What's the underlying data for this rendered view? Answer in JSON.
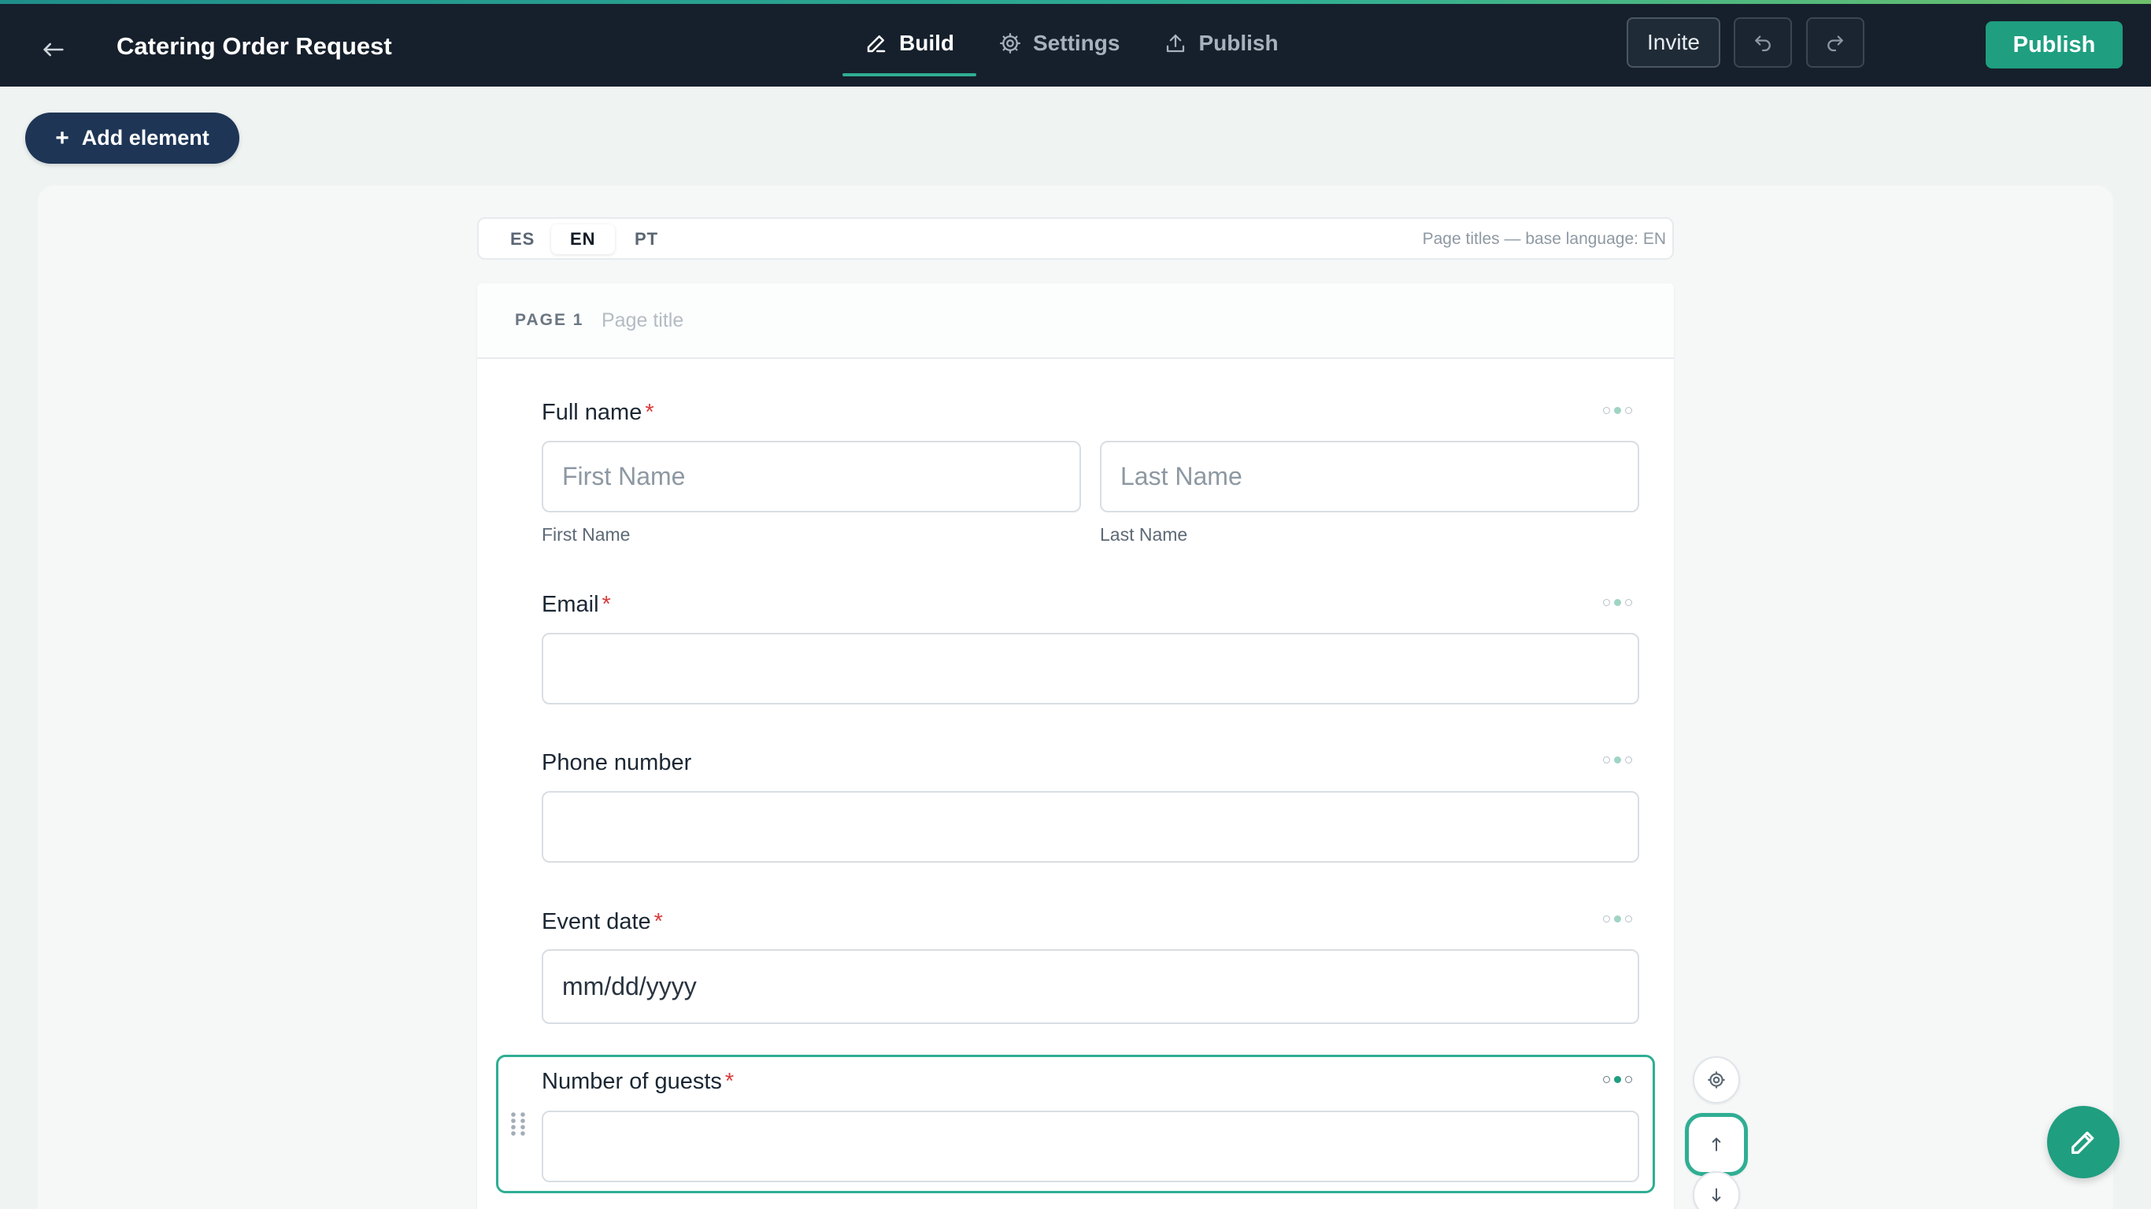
{
  "header": {
    "title": "Catering Order Request",
    "tabs": [
      {
        "label": "Build",
        "icon": "pencil-icon",
        "active": true
      },
      {
        "label": "Settings",
        "icon": "gear-icon",
        "active": false
      },
      {
        "label": "Publish",
        "icon": "upload-icon",
        "active": false
      }
    ],
    "invite_label": "Invite",
    "publish_label": "Publish"
  },
  "toolbar": {
    "add_element_label": "Add element"
  },
  "languages": {
    "tabs": [
      "ES",
      "EN",
      "PT"
    ],
    "active": "EN",
    "note": "Page titles — base language: EN"
  },
  "page": {
    "label": "PAGE 1",
    "title_placeholder": "Page title",
    "title_value": ""
  },
  "fields": {
    "full_name": {
      "label": "Full name",
      "required": "*",
      "first_placeholder": "First Name",
      "last_placeholder": "Last Name",
      "first_sublabel": "First Name",
      "last_sublabel": "Last Name"
    },
    "email": {
      "label": "Email",
      "required": "*",
      "value": ""
    },
    "phone": {
      "label": "Phone number",
      "value": ""
    },
    "event_date": {
      "label": "Event date",
      "required": "*",
      "placeholder": "mm/dd/yyyy"
    },
    "guests": {
      "label": "Number of guests",
      "required": "*",
      "value": "",
      "selected": true
    }
  },
  "colors": {
    "accent": "#1f9e80",
    "header_bg": "#16202c",
    "required": "#d93b3b",
    "selection": "#2fae93"
  }
}
